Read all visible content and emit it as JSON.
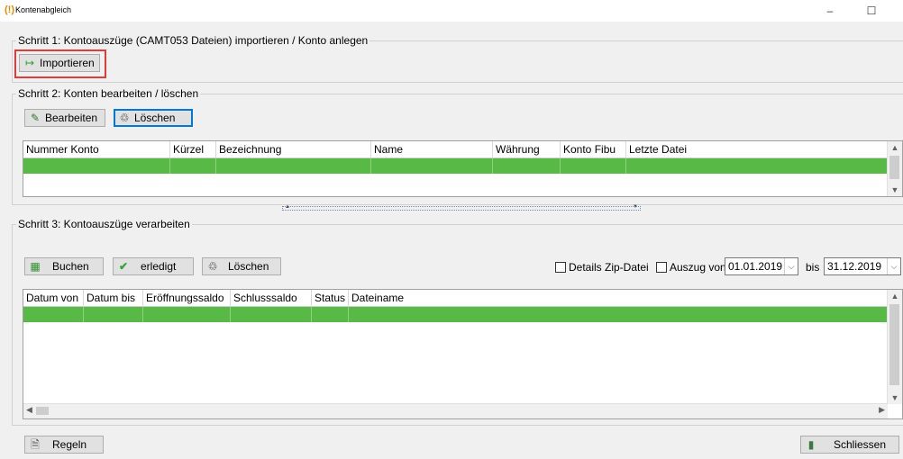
{
  "window": {
    "title": "Kontenabgleich",
    "minimize": "–",
    "maximize": "☐",
    "close": "✕"
  },
  "step1": {
    "label": "Schritt 1: Kontoauszüge (CAMT053 Dateien) importieren / Konto anlegen",
    "import_button": "Importieren"
  },
  "step2": {
    "label": "Schritt 2: Konten bearbeiten / löschen",
    "edit_button": "Bearbeiten",
    "delete_button": "Löschen",
    "columns": [
      "Nummer Konto",
      "Kürzel",
      "Bezeichnung",
      "Name",
      "Währung",
      "Konto Fibu",
      "Letzte Datei"
    ]
  },
  "step3": {
    "label": "Schritt 3: Kontoauszüge verarbeiten",
    "book_button": "Buchen",
    "done_button": "erledigt",
    "delete_button": "Löschen",
    "details_zip_label": "Details Zip-Datei",
    "auszug_von_label": "Auszug von",
    "date_from": "01.01.2019",
    "bis_label": "bis",
    "date_to": "31.12.2019",
    "columns": [
      "Datum von",
      "Datum bis",
      "Eröffnungssaldo",
      "Schlusssaldo",
      "Status",
      "Dateiname"
    ]
  },
  "footer": {
    "rules_button": "Regeln",
    "close_button": "Schliessen"
  },
  "colors": {
    "selected_row": "#58b947",
    "highlight_border": "#e23b3b"
  },
  "icons": {
    "import": "arrow-right-icon",
    "edit": "pencil-icon",
    "delete": "trash-icon",
    "book": "ledger-icon",
    "done": "checkmark-icon",
    "rules": "document-icon",
    "close": "door-exit-icon"
  }
}
